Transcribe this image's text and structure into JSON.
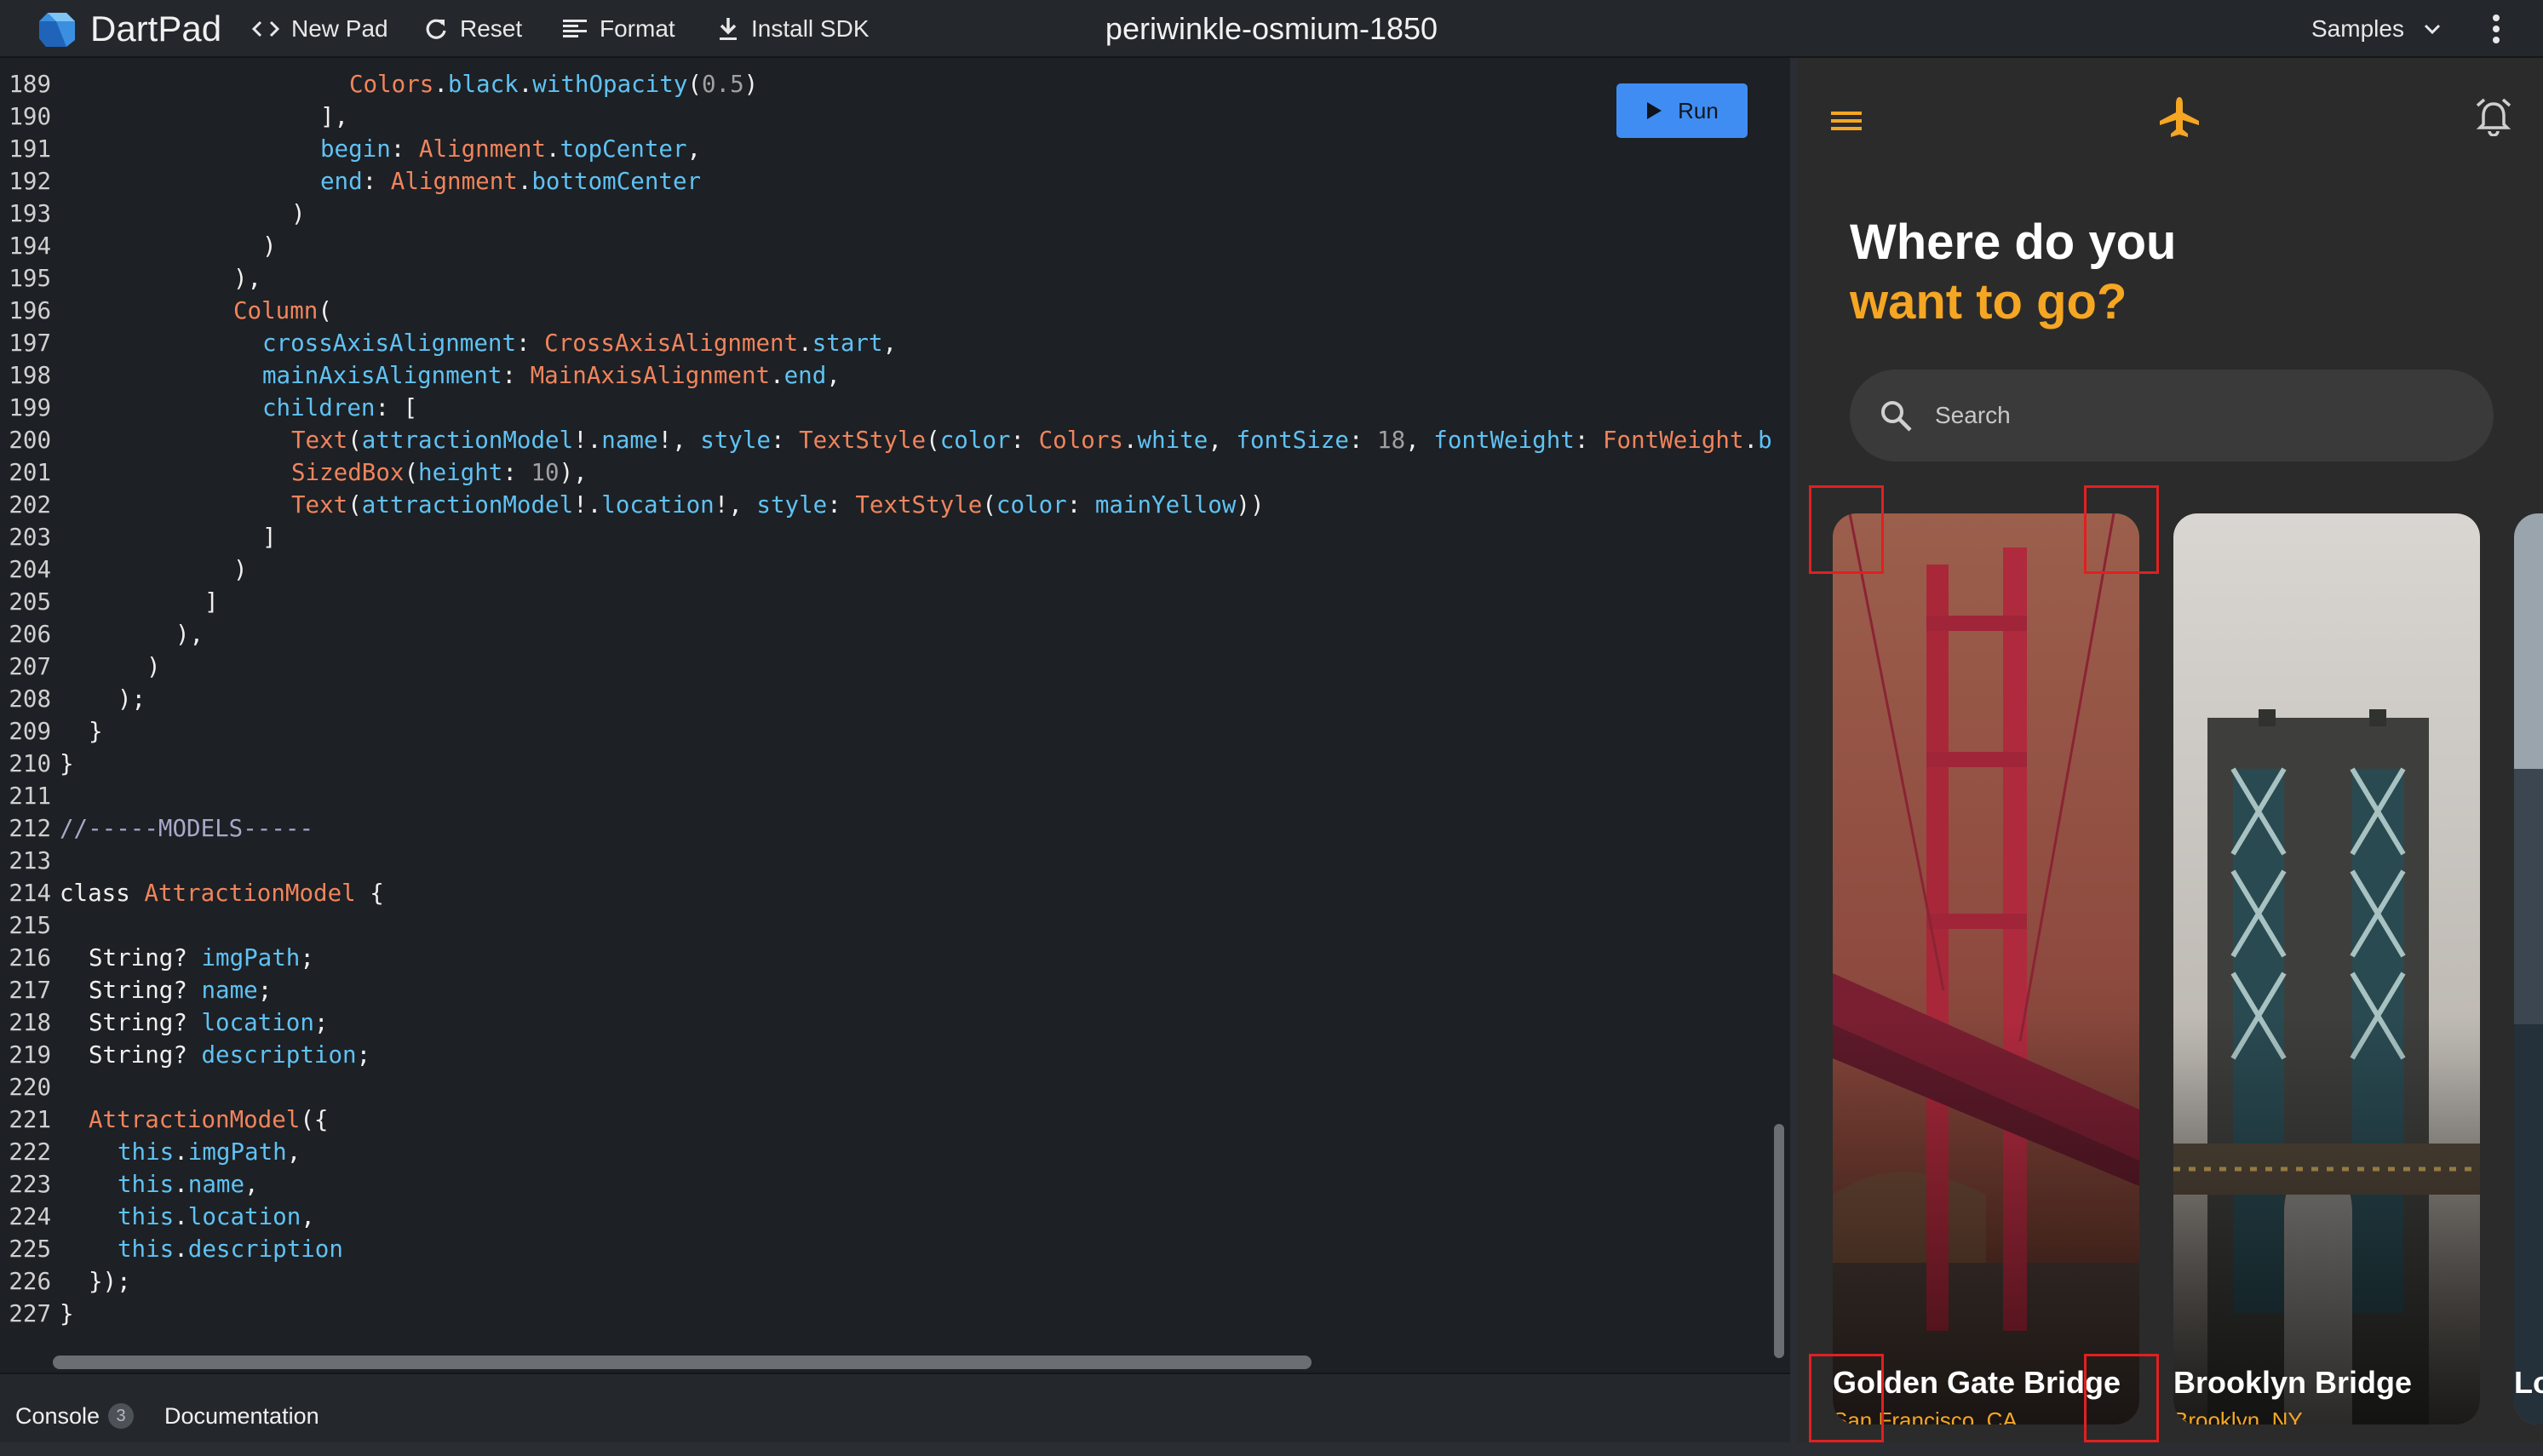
{
  "app": {
    "name": "DartPad",
    "pad_title": "periwinkle-osmium-1850"
  },
  "toolbar": {
    "new_pad": "New Pad",
    "reset": "Reset",
    "format": "Format",
    "install_sdk": "Install SDK",
    "samples": "Samples"
  },
  "editor": {
    "run_label": "Run",
    "lines": [
      {
        "n": "189",
        "indent": 10,
        "tokens": [
          [
            "t",
            "Colors"
          ],
          [
            "k",
            "."
          ],
          [
            "p",
            "black"
          ],
          [
            "k",
            "."
          ],
          [
            "p",
            "withOpacity"
          ],
          [
            "k",
            "("
          ],
          [
            "n",
            "0.5"
          ],
          [
            "k",
            ")"
          ]
        ]
      },
      {
        "n": "190",
        "indent": 9,
        "tokens": [
          [
            "k",
            "],"
          ]
        ]
      },
      {
        "n": "191",
        "indent": 9,
        "tokens": [
          [
            "p",
            "begin"
          ],
          [
            "k",
            ": "
          ],
          [
            "t",
            "Alignment"
          ],
          [
            "k",
            "."
          ],
          [
            "p",
            "topCenter"
          ],
          [
            "k",
            ","
          ]
        ]
      },
      {
        "n": "192",
        "indent": 9,
        "tokens": [
          [
            "p",
            "end"
          ],
          [
            "k",
            ": "
          ],
          [
            "t",
            "Alignment"
          ],
          [
            "k",
            "."
          ],
          [
            "p",
            "bottomCenter"
          ]
        ]
      },
      {
        "n": "193",
        "indent": 8,
        "tokens": [
          [
            "k",
            ")"
          ]
        ]
      },
      {
        "n": "194",
        "indent": 7,
        "tokens": [
          [
            "k",
            ")"
          ]
        ]
      },
      {
        "n": "195",
        "indent": 6,
        "tokens": [
          [
            "k",
            "),"
          ]
        ]
      },
      {
        "n": "196",
        "indent": 6,
        "tokens": [
          [
            "t",
            "Column"
          ],
          [
            "k",
            "("
          ]
        ]
      },
      {
        "n": "197",
        "indent": 7,
        "tokens": [
          [
            "p",
            "crossAxisAlignment"
          ],
          [
            "k",
            ": "
          ],
          [
            "t",
            "CrossAxisAlignment"
          ],
          [
            "k",
            "."
          ],
          [
            "p",
            "start"
          ],
          [
            "k",
            ","
          ]
        ]
      },
      {
        "n": "198",
        "indent": 7,
        "tokens": [
          [
            "p",
            "mainAxisAlignment"
          ],
          [
            "k",
            ": "
          ],
          [
            "t",
            "MainAxisAlignment"
          ],
          [
            "k",
            "."
          ],
          [
            "p",
            "end"
          ],
          [
            "k",
            ","
          ]
        ]
      },
      {
        "n": "199",
        "indent": 7,
        "tokens": [
          [
            "p",
            "children"
          ],
          [
            "k",
            ": ["
          ]
        ]
      },
      {
        "n": "200",
        "indent": 8,
        "tokens": [
          [
            "t",
            "Text"
          ],
          [
            "k",
            "("
          ],
          [
            "p",
            "attractionModel"
          ],
          [
            "k",
            "!."
          ],
          [
            "p",
            "name"
          ],
          [
            "k",
            "!, "
          ],
          [
            "p",
            "style"
          ],
          [
            "k",
            ": "
          ],
          [
            "t",
            "TextStyle"
          ],
          [
            "k",
            "("
          ],
          [
            "p",
            "color"
          ],
          [
            "k",
            ": "
          ],
          [
            "t",
            "Colors"
          ],
          [
            "k",
            "."
          ],
          [
            "p",
            "white"
          ],
          [
            "k",
            ", "
          ],
          [
            "p",
            "fontSize"
          ],
          [
            "k",
            ": "
          ],
          [
            "n",
            "18"
          ],
          [
            "k",
            ", "
          ],
          [
            "p",
            "fontWeight"
          ],
          [
            "k",
            ": "
          ],
          [
            "t",
            "FontWeight"
          ],
          [
            "k",
            "."
          ],
          [
            "p",
            "b"
          ]
        ]
      },
      {
        "n": "201",
        "indent": 8,
        "tokens": [
          [
            "t",
            "SizedBox"
          ],
          [
            "k",
            "("
          ],
          [
            "p",
            "height"
          ],
          [
            "k",
            ": "
          ],
          [
            "n",
            "10"
          ],
          [
            "k",
            "),"
          ]
        ]
      },
      {
        "n": "202",
        "indent": 8,
        "tokens": [
          [
            "t",
            "Text"
          ],
          [
            "k",
            "("
          ],
          [
            "p",
            "attractionModel"
          ],
          [
            "k",
            "!."
          ],
          [
            "p",
            "location"
          ],
          [
            "k",
            "!, "
          ],
          [
            "p",
            "style"
          ],
          [
            "k",
            ": "
          ],
          [
            "t",
            "TextStyle"
          ],
          [
            "k",
            "("
          ],
          [
            "p",
            "color"
          ],
          [
            "k",
            ": "
          ],
          [
            "p",
            "mainYellow"
          ],
          [
            "k",
            "))"
          ]
        ]
      },
      {
        "n": "203",
        "indent": 7,
        "tokens": [
          [
            "k",
            "]"
          ]
        ]
      },
      {
        "n": "204",
        "indent": 6,
        "tokens": [
          [
            "k",
            ")"
          ]
        ]
      },
      {
        "n": "205",
        "indent": 5,
        "tokens": [
          [
            "k",
            "]"
          ]
        ]
      },
      {
        "n": "206",
        "indent": 4,
        "tokens": [
          [
            "k",
            "),"
          ]
        ]
      },
      {
        "n": "207",
        "indent": 3,
        "tokens": [
          [
            "k",
            ")"
          ]
        ]
      },
      {
        "n": "208",
        "indent": 2,
        "tokens": [
          [
            "k",
            ");"
          ]
        ]
      },
      {
        "n": "209",
        "indent": 1,
        "tokens": [
          [
            "k",
            "}"
          ]
        ]
      },
      {
        "n": "210",
        "indent": 0,
        "tokens": [
          [
            "k",
            "}"
          ]
        ]
      },
      {
        "n": "211",
        "indent": 0,
        "tokens": []
      },
      {
        "n": "212",
        "indent": 0,
        "tokens": [
          [
            "c",
            "//-----MODELS-----"
          ]
        ]
      },
      {
        "n": "213",
        "indent": 0,
        "tokens": []
      },
      {
        "n": "214",
        "indent": 0,
        "tokens": [
          [
            "k",
            "class "
          ],
          [
            "t",
            "AttractionModel"
          ],
          [
            "k",
            " {"
          ]
        ]
      },
      {
        "n": "215",
        "indent": 0,
        "tokens": []
      },
      {
        "n": "216",
        "indent": 1,
        "tokens": [
          [
            "k",
            "String? "
          ],
          [
            "p",
            "imgPath"
          ],
          [
            "k",
            ";"
          ]
        ]
      },
      {
        "n": "217",
        "indent": 1,
        "tokens": [
          [
            "k",
            "String? "
          ],
          [
            "p",
            "name"
          ],
          [
            "k",
            ";"
          ]
        ]
      },
      {
        "n": "218",
        "indent": 1,
        "tokens": [
          [
            "k",
            "String? "
          ],
          [
            "p",
            "location"
          ],
          [
            "k",
            ";"
          ]
        ]
      },
      {
        "n": "219",
        "indent": 1,
        "tokens": [
          [
            "k",
            "String? "
          ],
          [
            "p",
            "description"
          ],
          [
            "k",
            ";"
          ]
        ]
      },
      {
        "n": "220",
        "indent": 0,
        "tokens": []
      },
      {
        "n": "221",
        "indent": 1,
        "tokens": [
          [
            "t",
            "AttractionModel"
          ],
          [
            "k",
            "({"
          ]
        ]
      },
      {
        "n": "222",
        "indent": 2,
        "tokens": [
          [
            "p",
            "this"
          ],
          [
            "k",
            "."
          ],
          [
            "p",
            "imgPath"
          ],
          [
            "k",
            ","
          ]
        ]
      },
      {
        "n": "223",
        "indent": 2,
        "tokens": [
          [
            "p",
            "this"
          ],
          [
            "k",
            "."
          ],
          [
            "p",
            "name"
          ],
          [
            "k",
            ","
          ]
        ]
      },
      {
        "n": "224",
        "indent": 2,
        "tokens": [
          [
            "p",
            "this"
          ],
          [
            "k",
            "."
          ],
          [
            "p",
            "location"
          ],
          [
            "k",
            ","
          ]
        ]
      },
      {
        "n": "225",
        "indent": 2,
        "tokens": [
          [
            "p",
            "this"
          ],
          [
            "k",
            "."
          ],
          [
            "p",
            "description"
          ]
        ]
      },
      {
        "n": "226",
        "indent": 1,
        "tokens": [
          [
            "k",
            "});"
          ]
        ]
      },
      {
        "n": "227",
        "indent": 0,
        "tokens": [
          [
            "k",
            "}"
          ]
        ]
      }
    ]
  },
  "bottom": {
    "console": "Console",
    "console_count": "3",
    "documentation": "Documentation"
  },
  "preview": {
    "headline_line1": "Where do you",
    "headline_line2": "want to go?",
    "search_placeholder": "Search",
    "menu_icon": "menu-icon",
    "plane_icon": "airplane-icon",
    "bell_icon": "alarm-bell-icon",
    "accent_color": "#f5a623",
    "cards": [
      {
        "name": "Golden Gate Bridge",
        "location": "San Francisco, CA"
      },
      {
        "name": "Brooklyn Bridge",
        "location": "Brooklyn, NY"
      },
      {
        "name": "Lo",
        "location": ""
      }
    ]
  }
}
